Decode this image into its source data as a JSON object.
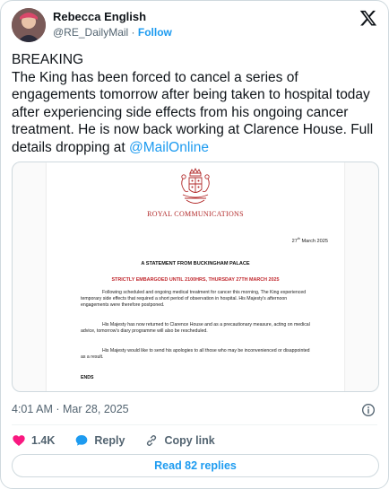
{
  "author": {
    "name": "Rebecca English",
    "handle": "@RE_DailyMail",
    "separator": "·",
    "follow_label": "Follow"
  },
  "tweet": {
    "line_breaking": "BREAKING",
    "body": "The King has been forced to cancel a series of engagements tomorrow after being taken to hospital today after experiencing side effects from his ongoing cancer treatment. He is now back working at Clarence House. Full details dropping at ",
    "mention": "@MailOnline",
    "timestamp": "4:01 AM · Mar 28, 2025"
  },
  "letter": {
    "header": "ROYAL COMMUNICATIONS",
    "date_day": "27",
    "date_suffix": "th",
    "date_rest": " March 2025",
    "statement_title": "A STATEMENT FROM BUCKINGHAM PALACE",
    "embargo": "STRICTLY EMBARGOED UNTIL 2100HRS, THURSDAY 27TH MARCH 2025",
    "paragraph_1": "Following scheduled and ongoing medical treatment for cancer this morning, The King experienced temporary side effects that required a short period of observation in hospital. His Majesty's afternoon engagements were therefore postponed.",
    "paragraph_2": "His Majesty has now returned to Clarence House and as a precautionary measure, acting on medical advice, tomorrow's diary programme will also be rescheduled.",
    "paragraph_3": "His Majesty would like to send his apologies to all those who may be inconvenienced or disappointed as a result.",
    "ends": "ENDS"
  },
  "actions": {
    "likes": "1.4K",
    "reply_label": "Reply",
    "copy_link_label": "Copy link"
  },
  "read_replies_label": "Read 82 replies",
  "colors": {
    "accent": "#1d9bf0",
    "like": "#f91880",
    "royal_red": "#b22a2a",
    "embargo_red": "#c0272d",
    "muted": "#536471"
  },
  "icons": {
    "platform": "x-logo-icon",
    "like": "heart-icon",
    "reply": "speech-bubble-icon",
    "copy": "link-icon",
    "info": "info-icon",
    "crest": "royal-crest-icon"
  }
}
